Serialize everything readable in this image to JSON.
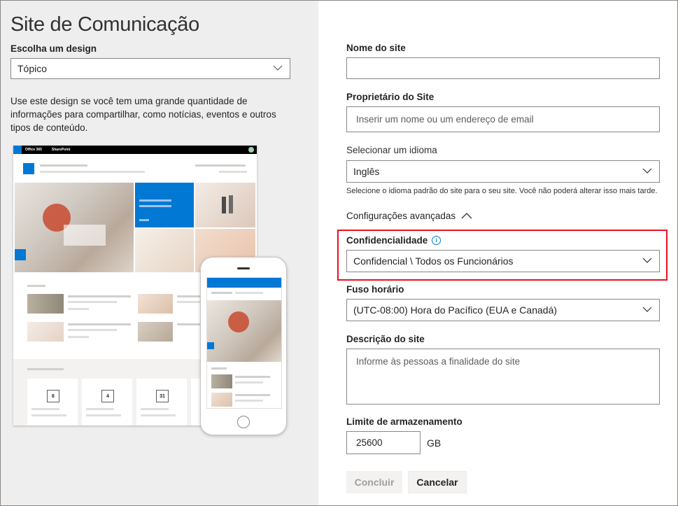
{
  "left": {
    "title": "Site de Comunicação",
    "design_label": "Escolha um design",
    "design_value": "Tópico",
    "description": "Use este design se você tem uma grande quantidade de informações para compartilhar, como notícias, eventos e outros tipos de conteúdo.",
    "preview": {
      "suite_label": "Office 365",
      "app_label": "SharePoint",
      "calendar_days": [
        "6",
        "4",
        "31"
      ]
    }
  },
  "form": {
    "site_name": {
      "label": "Nome do site",
      "value": ""
    },
    "owner": {
      "label": "Proprietário do Site",
      "placeholder": "Inserir um nome ou um endereço de email"
    },
    "language": {
      "label": "Selecionar um idioma",
      "value": "Inglês",
      "hint": "Selecione o idioma padrão do site para o seu site. Você não poderá alterar isso mais tarde."
    },
    "advanced": {
      "label": "Configurações avançadas"
    },
    "confidentiality": {
      "label": "Confidencialidade",
      "value": "Confidencial \\ Todos os Funcionários",
      "highlight_color": "#e81123"
    },
    "timezone": {
      "label": "Fuso horário",
      "value": "(UTC-08:00) Hora do Pacífico (EUA e Canadá)"
    },
    "description": {
      "label": "Descrição do site",
      "placeholder": "Informe às pessoas a finalidade do site"
    },
    "storage": {
      "label": "Limite de armazenamento",
      "value": "25600",
      "unit": "GB"
    },
    "buttons": {
      "finish": "Concluir",
      "cancel": "Cancelar"
    }
  },
  "colors": {
    "accent": "#0078d4",
    "left_bg": "#eeeeee",
    "disabled_btn": "#f3f2f1"
  }
}
